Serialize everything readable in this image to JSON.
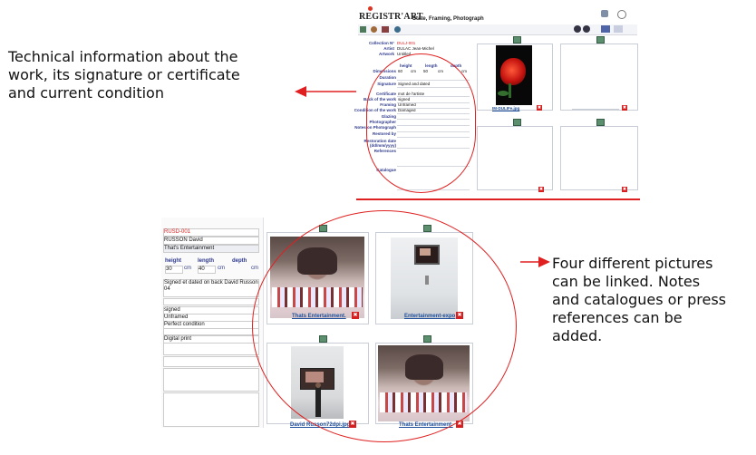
{
  "callouts": {
    "left_text": [
      "Technical information about the",
      "work, its signature or certificate",
      "and current condition"
    ],
    "right_text": [
      "Four different pictures",
      "can be linked. Notes",
      "and catalogues or press",
      "references can be",
      "added."
    ]
  },
  "app_top": {
    "logo": "REGISTR'ART",
    "window_title": "State, Framing, Photograph",
    "collection_label": "Collection N°",
    "collection_value": "DULJ-001",
    "artist_label": "Artist",
    "artist_value": "DULAC Jean-Michel",
    "artwork_label": "Artwork",
    "artwork_value": "Untitled",
    "dims_headers": [
      "height",
      "length",
      "depth"
    ],
    "dimensions_label": "Dimensions",
    "dimensions_values": [
      "60",
      "cm",
      "50",
      "cm",
      "cm"
    ],
    "rows": [
      {
        "label": "Duration",
        "value": ""
      },
      {
        "label": "Signature",
        "value": "Signed and dated"
      },
      {
        "label": "Certificate",
        "value": "mot de l'artiste"
      },
      {
        "label": "Back of the work",
        "value": "signed"
      },
      {
        "label": "Framing",
        "value": "Unframed"
      },
      {
        "label": "Condition of the work",
        "value": "Damaged"
      },
      {
        "label": "Glazing",
        "value": ""
      },
      {
        "label": "Photographer",
        "value": ""
      },
      {
        "label": "Notes on Photograph",
        "value": ""
      },
      {
        "label": "Restored by",
        "value": ""
      },
      {
        "label": "Restoration date (dd/mm/yyyy)",
        "value": ""
      },
      {
        "label": "References",
        "value": ""
      },
      {
        "label": "Catalogue",
        "value": ""
      }
    ],
    "photo_caption": "IM-DULIFe.jpg"
  },
  "app_bottom": {
    "collection_value": "RUSD-001",
    "artist_value": "RUSSON David",
    "artwork_value": "That's Entertainment",
    "dims_headers": [
      "height",
      "length",
      "depth"
    ],
    "dims_values": [
      "30",
      "cm",
      "40",
      "cm",
      "cm"
    ],
    "signature_value": "Signed et dated on back David Russon 04",
    "back_value": "signed",
    "framing_value": "Unframed",
    "condition_value": "Perfect condition",
    "technique_value": "Digital print",
    "captions": [
      "Thats Entertainment.",
      "Entertainment-expo",
      "David Russon72dpi.jpg",
      "Thats Entertainment."
    ],
    "x_glyph": "✖"
  },
  "colors": {
    "accent_red": "#e02020",
    "label_blue": "#2e3a8c",
    "link_blue": "#1f4f9a"
  }
}
